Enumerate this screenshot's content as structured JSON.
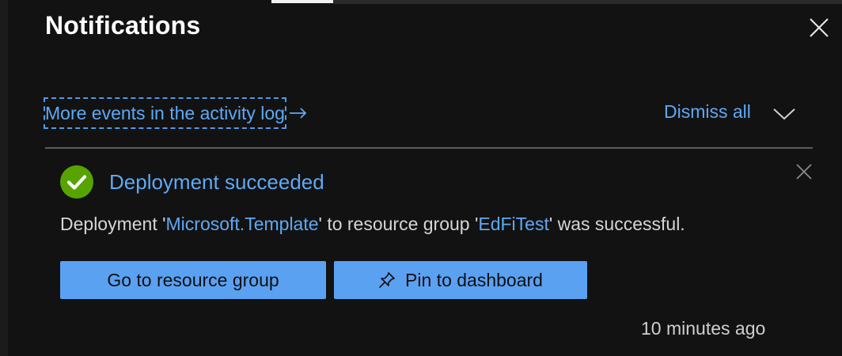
{
  "panel": {
    "title": "Notifications",
    "activity_link": "More events in the activity log",
    "dismiss_all": "Dismiss all"
  },
  "notification": {
    "title": "Deployment succeeded",
    "body_prefix": "Deployment '",
    "template_name": "Microsoft.Template",
    "body_middle": "' to resource group '",
    "resource_group": "EdFiTest",
    "body_suffix": "' was successful.",
    "primary_button": "Go to resource group",
    "secondary_button": "Pin to dashboard",
    "timestamp": "10 minutes ago"
  },
  "icons": {
    "close": "close-icon",
    "arrow": "arrow-right-icon",
    "chevron": "chevron-down-icon",
    "success": "success-check-icon",
    "pin": "pin-icon"
  },
  "colors": {
    "background": "#121212",
    "link": "#5ea9f5",
    "button": "#5ba1f2",
    "success": "#57a300"
  }
}
